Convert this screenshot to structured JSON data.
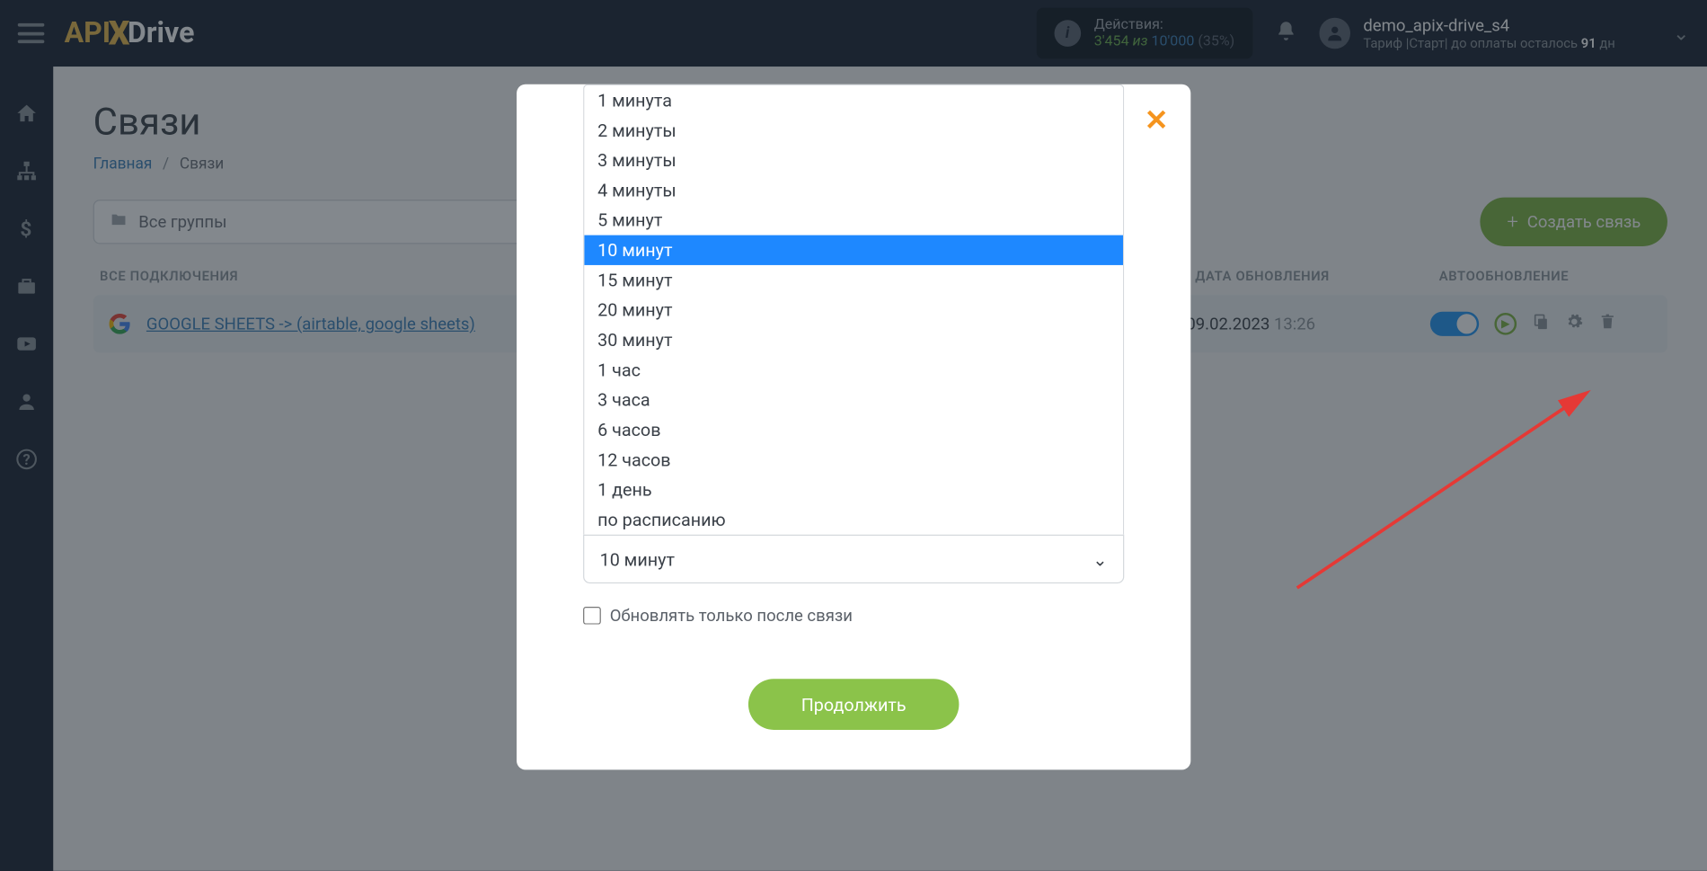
{
  "topbar": {
    "logo_api": "API",
    "logo_drive": "Drive",
    "actions_label": "Действия:",
    "actions_used": "3'454",
    "actions_iz": "из",
    "actions_total": "10'000",
    "actions_pct": "(35%)",
    "user_name": "demo_apix-drive_s4",
    "user_plan_prefix": "Тариф |Старт| до оплаты осталось ",
    "user_plan_days": "91",
    "user_plan_suffix": " дн"
  },
  "page": {
    "title": "Связи",
    "breadcrumb_home": "Главная",
    "breadcrumb_current": "Связи",
    "group_select": "Все группы",
    "create_button": "Создать связь",
    "col_connections": "ВСЕ ПОДКЛЮЧЕНИЯ",
    "col_date": "ДАТА ОБНОВЛЕНИЯ",
    "col_auto": "АВТООБНОВЛЕНИЕ"
  },
  "connection": {
    "name": "GOOGLE SHEETS -> (airtable, google sheets)",
    "date": "09.02.2023",
    "time": "13:26"
  },
  "modal": {
    "options": [
      "1 минута",
      "2 минуты",
      "3 минуты",
      "4 минуты",
      "5 минут",
      "10 минут",
      "15 минут",
      "20 минут",
      "30 минут",
      "1 час",
      "3 часа",
      "6 часов",
      "12 часов",
      "1 день",
      "по расписанию"
    ],
    "selected_index": 5,
    "selected_value": "10 минут",
    "checkbox_label": "Обновлять только после связи",
    "continue_button": "Продолжить"
  }
}
